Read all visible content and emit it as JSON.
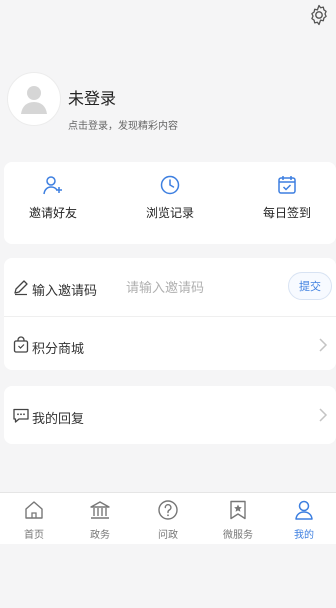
{
  "profile": {
    "name": "未登录",
    "subtitle": "点击登录，发现精彩内容"
  },
  "quick_actions": [
    {
      "label": "邀请好友",
      "icon": "add-user-icon"
    },
    {
      "label": "浏览记录",
      "icon": "clock-icon"
    },
    {
      "label": "每日签到",
      "icon": "calendar-check-icon"
    }
  ],
  "invite": {
    "label": "输入邀请码",
    "placeholder": "请输入邀请码",
    "submit_label": "提交",
    "icon": "pencil-icon"
  },
  "menu": {
    "points_mall": {
      "label": "积分商城",
      "icon": "shopping-bag-icon"
    },
    "my_replies": {
      "label": "我的回复",
      "icon": "chat-bubble-icon"
    }
  },
  "tabbar": [
    {
      "label": "首页",
      "icon": "home-icon"
    },
    {
      "label": "政务",
      "icon": "government-building-icon"
    },
    {
      "label": "问政",
      "icon": "question-icon"
    },
    {
      "label": "微服务",
      "icon": "bookmark-star-icon"
    },
    {
      "label": "我的",
      "icon": "user-icon",
      "active": true
    }
  ],
  "colors": {
    "accent": "#3d7fe0",
    "background": "#f5f5f6"
  }
}
